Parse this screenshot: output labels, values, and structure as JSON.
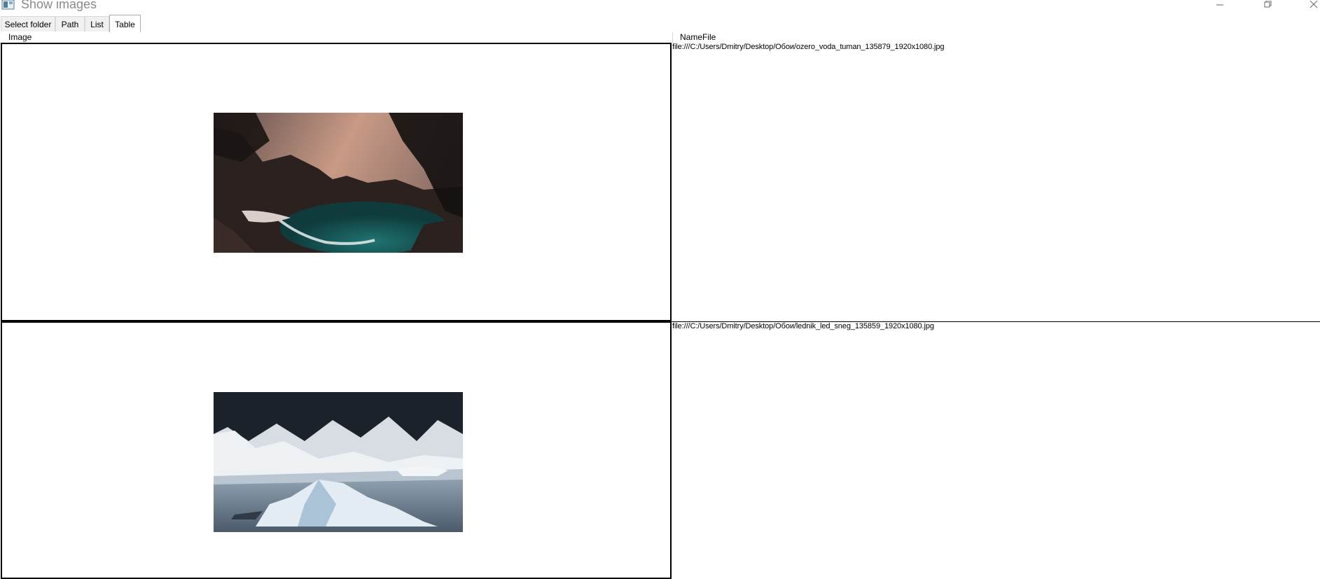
{
  "window": {
    "title": "Show images",
    "controls": [
      "minimize-icon",
      "restore-icon",
      "close-icon"
    ]
  },
  "tabs": [
    {
      "label": "Select folder",
      "active": false
    },
    {
      "label": "Path",
      "active": false
    },
    {
      "label": "List",
      "active": false
    },
    {
      "label": "Table",
      "active": true
    }
  ],
  "table": {
    "columns": [
      "Image",
      "NameFile"
    ],
    "rows": [
      {
        "image": "coastal cove with turquoise water and dark cliffs at dusk",
        "name_file": "file:///C:/Users/Dmitry/Desktop/Обои/ozero_voda_tuman_135879_1920x1080.jpg"
      },
      {
        "image": "glacier with icebergs floating in front of snowy mountains",
        "name_file": "file:///C:/Users/Dmitry/Desktop/Обои/lednik_led_sneg_135859_1920x1080.jpg"
      }
    ]
  }
}
